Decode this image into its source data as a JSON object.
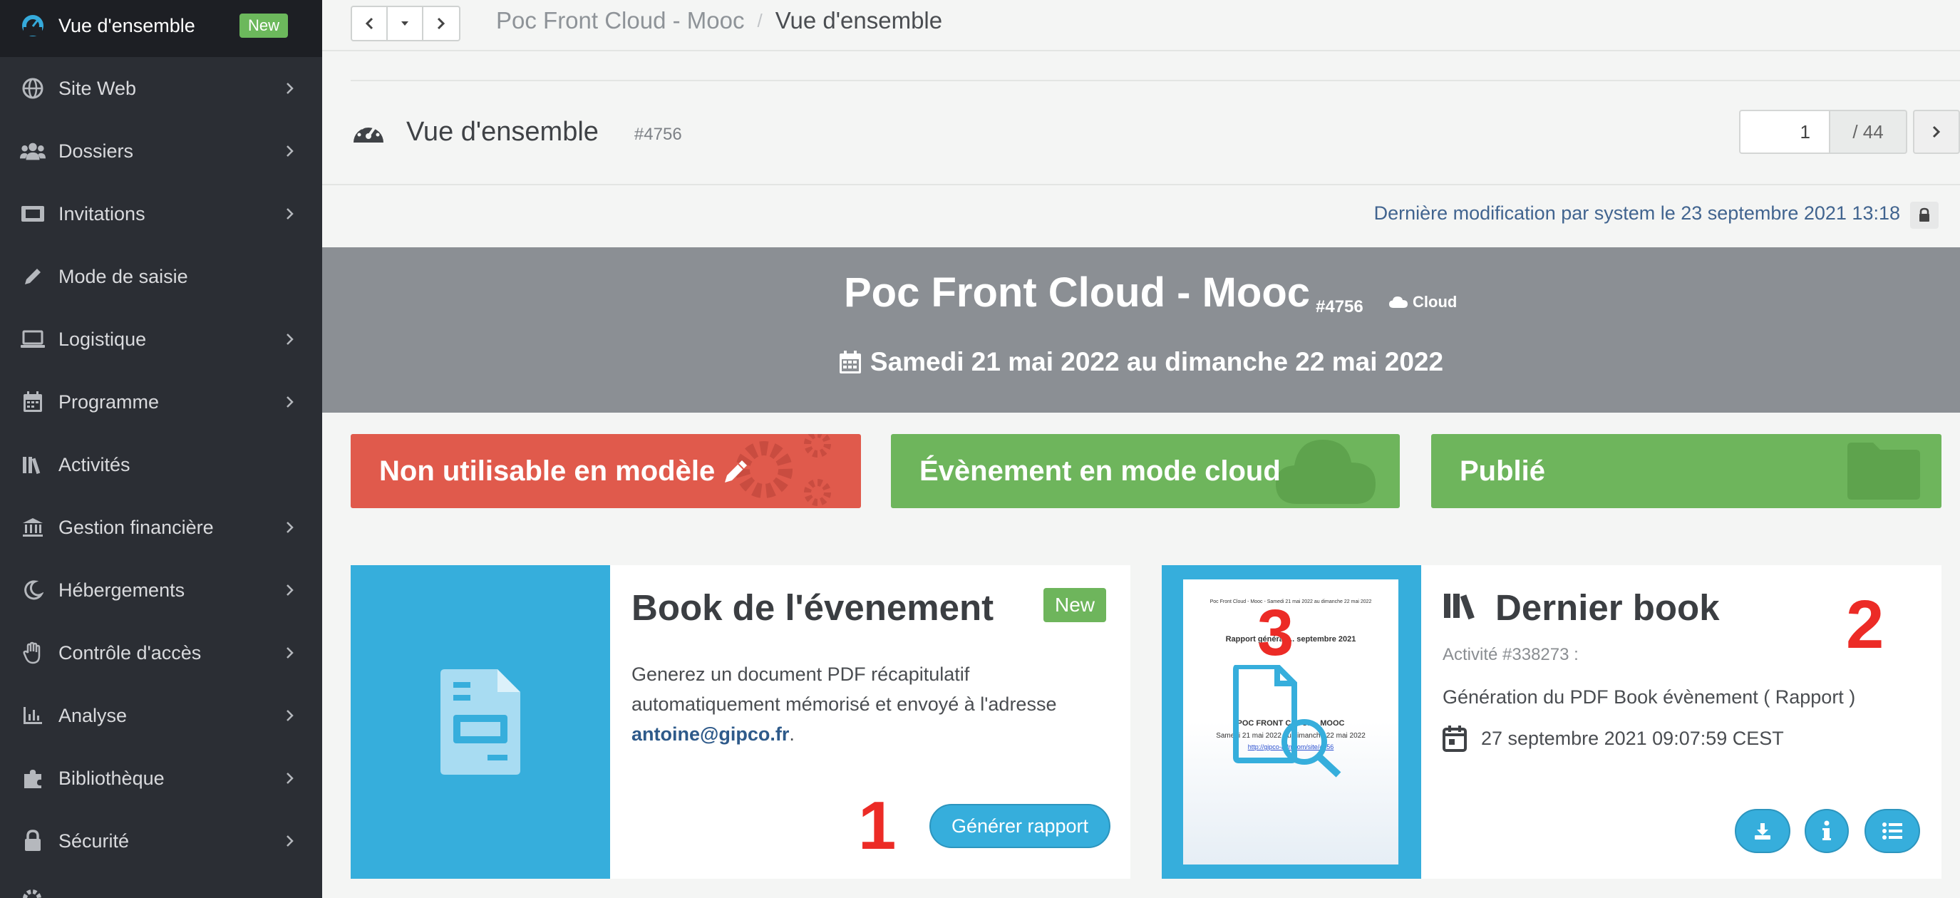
{
  "sidebar": {
    "items": [
      {
        "label": "Vue d'ensemble",
        "badge": "New",
        "icon": "dashboard-icon"
      },
      {
        "label": "Site Web",
        "icon": "globe-icon"
      },
      {
        "label": "Dossiers",
        "icon": "users-icon"
      },
      {
        "label": "Invitations",
        "icon": "ticket-icon"
      },
      {
        "label": "Mode de saisie",
        "icon": "pencil-icon"
      },
      {
        "label": "Logistique",
        "icon": "laptop-icon"
      },
      {
        "label": "Programme",
        "icon": "calendar-icon"
      },
      {
        "label": "Activités",
        "icon": "library-icon"
      },
      {
        "label": "Gestion financière",
        "icon": "bank-icon"
      },
      {
        "label": "Hébergements",
        "icon": "moon-icon"
      },
      {
        "label": "Contrôle d'accès",
        "icon": "hand-icon"
      },
      {
        "label": "Analyse",
        "icon": "chart-icon"
      },
      {
        "label": "Bibliothèque",
        "icon": "puzzle-icon"
      },
      {
        "label": "Sécurité",
        "icon": "lock-icon"
      }
    ]
  },
  "breadcrumb": {
    "parent": "Poc Front Cloud - Mooc",
    "separator": "/",
    "current": "Vue d'ensemble"
  },
  "header": {
    "title": "Vue d'ensemble",
    "id": "#4756"
  },
  "pager": {
    "current": "1",
    "total": "/ 44"
  },
  "last_modified": "Dernière modification par system le 23 septembre 2021 13:18",
  "event": {
    "name": "Poc Front Cloud - Mooc",
    "id": "#4756",
    "tag": "Cloud",
    "dates": "Samedi 21 mai 2022 au dimanche 22 mai 2022"
  },
  "statuses": [
    {
      "label": "Non utilisable en modèle",
      "color": "#e05a4c"
    },
    {
      "label": "Évènement en mode cloud",
      "color": "#6eb55c"
    },
    {
      "label": "Publié",
      "color": "#6eb55c"
    }
  ],
  "book_card": {
    "title": "Book de l'évenement",
    "badge": "New",
    "desc": "Generez un document PDF récapitulatif automatiquement mémorisé et envoyé à l'adresse",
    "email": "antoine@gipco.fr",
    "button": "Générer rapport"
  },
  "last_book": {
    "title": "Dernier book",
    "activity": "Activité #338273 :",
    "desc": "Génération du PDF Book évènement ( Rapport )",
    "date": "27 septembre 2021 09:07:59 CEST",
    "thumb_header": "Poc Front Cloud - Mooc - Samedi 21 mai 2022 au dimanche 22 mai 2022",
    "thumb_title": "Rapport général ... septembre 2021",
    "thumb_event": "POC FRONT CLOUD - MOOC",
    "thumb_dates": "Samedi 21 mai 2022 au dimanche 22 mai 2022",
    "thumb_url": "http://gipco-adn.com/site/4756"
  },
  "annotations": {
    "one": "1",
    "two": "2",
    "three": "3"
  }
}
